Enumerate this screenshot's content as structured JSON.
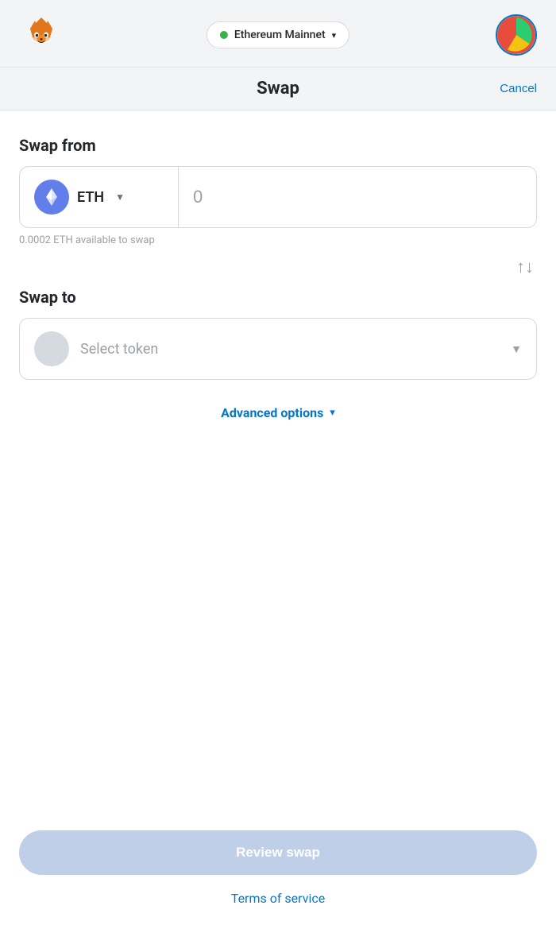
{
  "header": {
    "network_label": "Ethereum Mainnet",
    "network_status": "connected"
  },
  "title_bar": {
    "title": "Swap",
    "cancel_label": "Cancel"
  },
  "swap_from": {
    "section_label": "Swap from",
    "token_symbol": "ETH",
    "amount_value": "0",
    "amount_placeholder": "0",
    "available_text": "0.0002 ETH available to swap"
  },
  "swap_to": {
    "section_label": "Swap to",
    "placeholder_text": "Select token"
  },
  "advanced": {
    "label": "Advanced options"
  },
  "actions": {
    "review_swap_label": "Review swap",
    "terms_label": "Terms of service"
  }
}
